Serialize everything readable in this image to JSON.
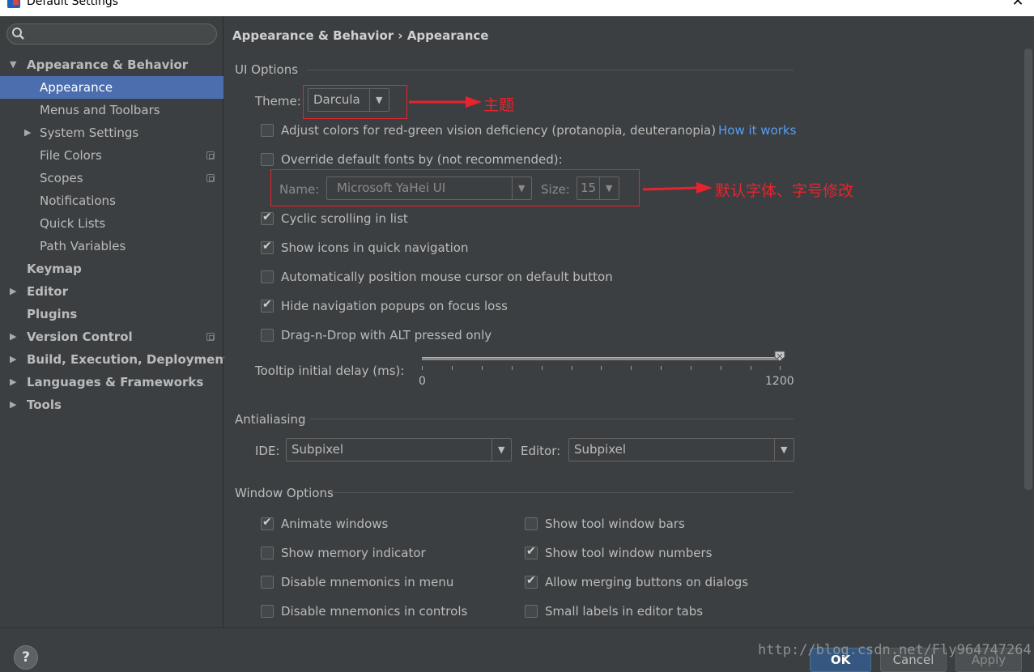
{
  "window": {
    "title": "Default Settings"
  },
  "sidebar": {
    "search": {
      "value": "",
      "placeholder": ""
    },
    "items": [
      {
        "label": "Appearance & Behavior",
        "level": 0,
        "expanded": true,
        "bold": true
      },
      {
        "label": "Appearance",
        "level": 1,
        "selected": true
      },
      {
        "label": "Menus and Toolbars",
        "level": 1
      },
      {
        "label": "System Settings",
        "level": 1,
        "expandable": true
      },
      {
        "label": "File Colors",
        "level": 1,
        "project_icon": true
      },
      {
        "label": "Scopes",
        "level": 1,
        "project_icon": true
      },
      {
        "label": "Notifications",
        "level": 1
      },
      {
        "label": "Quick Lists",
        "level": 1
      },
      {
        "label": "Path Variables",
        "level": 1
      },
      {
        "label": "Keymap",
        "level": 0,
        "bold": true
      },
      {
        "label": "Editor",
        "level": 0,
        "bold": true,
        "expandable": true
      },
      {
        "label": "Plugins",
        "level": 0,
        "bold": true
      },
      {
        "label": "Version Control",
        "level": 0,
        "bold": true,
        "expandable": true,
        "project_icon": true
      },
      {
        "label": "Build, Execution, Deployment",
        "level": 0,
        "bold": true,
        "expandable": true
      },
      {
        "label": "Languages & Frameworks",
        "level": 0,
        "bold": true,
        "expandable": true
      },
      {
        "label": "Tools",
        "level": 0,
        "bold": true,
        "expandable": true
      }
    ]
  },
  "main": {
    "breadcrumb": "Appearance & Behavior › Appearance",
    "ui_options": {
      "title": "UI Options",
      "theme_label": "Theme:",
      "theme_value": "Darcula",
      "adjust_colors": {
        "label": "Adjust colors for red-green vision deficiency (protanopia, deuteranopia)",
        "checked": false
      },
      "how_it_works": "How it works",
      "override_fonts": {
        "label": "Override default fonts by (not recommended):",
        "checked": false
      },
      "font_name_label": "Name:",
      "font_name_value": "Microsoft YaHei UI",
      "font_size_label": "Size:",
      "font_size_value": "15",
      "cyclic_scrolling": {
        "label": "Cyclic scrolling in list",
        "checked": true
      },
      "show_icons": {
        "label": "Show icons in quick navigation",
        "checked": true
      },
      "auto_position": {
        "label": "Automatically position mouse cursor on default button",
        "checked": false
      },
      "hide_popups": {
        "label": "Hide navigation popups on focus loss",
        "checked": true
      },
      "drag_drop": {
        "label": "Drag-n-Drop with ALT pressed only",
        "checked": false
      },
      "tooltip_label": "Tooltip initial delay (ms):",
      "tooltip_min": "0",
      "tooltip_max": "1200",
      "tooltip_value": 1200
    },
    "antialiasing": {
      "title": "Antialiasing",
      "ide_label": "IDE:",
      "ide_value": "Subpixel",
      "editor_label": "Editor:",
      "editor_value": "Subpixel"
    },
    "window_options": {
      "title": "Window Options",
      "animate_windows": {
        "label": "Animate windows",
        "checked": true
      },
      "show_memory": {
        "label": "Show memory indicator",
        "checked": false
      },
      "disable_mnemonics_menu": {
        "label": "Disable mnemonics in menu",
        "checked": false
      },
      "disable_mnemonics_controls": {
        "label": "Disable mnemonics in controls",
        "checked": false
      },
      "show_tool_bars": {
        "label": "Show tool window bars",
        "checked": false
      },
      "show_tool_numbers": {
        "label": "Show tool window numbers",
        "checked": true
      },
      "allow_merging": {
        "label": "Allow merging buttons on dialogs",
        "checked": true
      },
      "small_labels": {
        "label": "Small labels in editor tabs",
        "checked": false
      }
    }
  },
  "annotations": {
    "theme_note": "主题",
    "font_note": "默认字体、字号修改",
    "color": "#e8232f"
  },
  "footer": {
    "help": "?",
    "ok": "OK",
    "cancel": "Cancel",
    "apply": "Apply",
    "watermark": "http://blog.csdn.net/Fly964747264"
  },
  "colors": {
    "background": "#3c3f41",
    "selection": "#4b6eaf",
    "link": "#589df6",
    "text": "#bbbbbb"
  }
}
